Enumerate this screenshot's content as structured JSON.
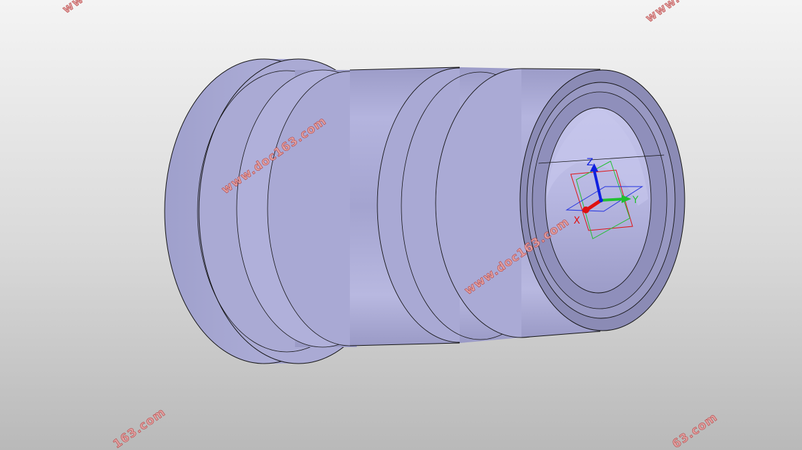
{
  "viewport": {
    "background_top": "#f4f4f4",
    "background_bottom": "#b9b9b9",
    "model_color": "#a8a8d2",
    "model_edge_color": "#111111"
  },
  "watermark": {
    "text": "www.doc163.com",
    "fragment_top_left": "www",
    "fragment_top_right": "www.",
    "fragment_bottom_left": "163.com",
    "fragment_bottom_right": "63.com",
    "color": "#c04040"
  },
  "triad": {
    "x_label": "X",
    "y_label": "Y",
    "z_label": "Z",
    "x_color": "#e01010",
    "y_color": "#20c030",
    "z_color": "#1020e0"
  }
}
